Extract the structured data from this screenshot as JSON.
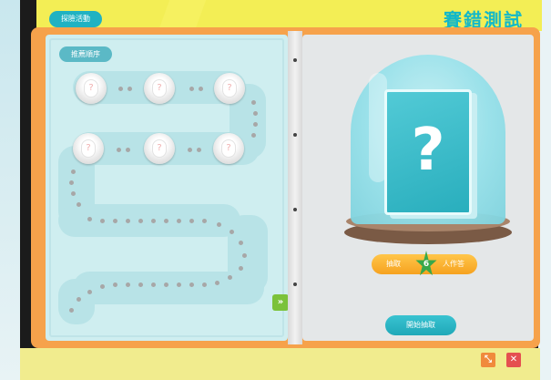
{
  "header": {
    "tag_label": "探險活動",
    "title": "賽錯測試"
  },
  "left_page": {
    "sequence_label": "推薦順序",
    "slot_symbol": "?",
    "next_symbol": "»"
  },
  "right_page": {
    "card_symbol": "?",
    "draw": {
      "prefix": "抽取",
      "count": "6",
      "suffix": "人作答"
    },
    "start_label": "開始抽取"
  },
  "window_controls": {
    "resize_symbol": "⤡",
    "close_symbol": "✕"
  },
  "colors": {
    "accent": "#20b2c2",
    "banner": "#f3ee55",
    "book": "#f6a24b",
    "path": "#b8e3e7",
    "close": "#e55050",
    "resize": "#f08a3c"
  }
}
